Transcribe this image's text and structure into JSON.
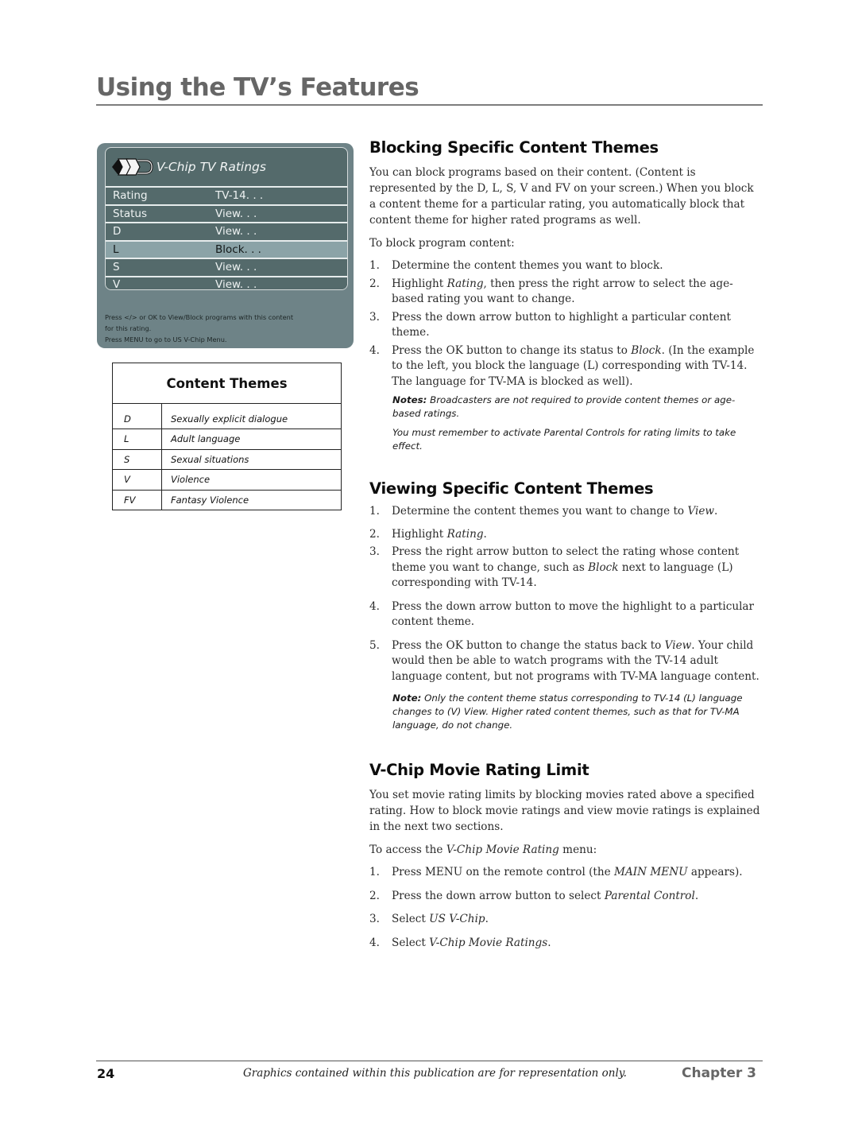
{
  "header": {
    "title": "Using the TV’s Features"
  },
  "tv_menu": {
    "icon": "v-chip-tv-icon",
    "title": "V-Chip TV Ratings",
    "rows": [
      {
        "label": "Rating",
        "value": "TV-14. . .",
        "selected": false
      },
      {
        "label": "Status",
        "value": "View. . .",
        "selected": false
      },
      {
        "label": "D",
        "value": "View. . .",
        "selected": false
      },
      {
        "label": "L",
        "value": "Block. . .",
        "selected": true
      },
      {
        "label": "S",
        "value": "View. . .",
        "selected": false
      },
      {
        "label": "V",
        "value": "View. . .",
        "selected": false
      }
    ],
    "help": [
      "Press </> or OK to View/Block programs with this content",
      "for this rating.",
      "Press MENU to go to US V-Chip Menu."
    ],
    "colors": {
      "panel": "#6e8387",
      "row": "#546a6b",
      "selected_row": "#8ba3a7"
    }
  },
  "content_themes": {
    "title": "Content Themes",
    "rows": [
      {
        "code": "D",
        "desc": "Sexually explicit dialogue"
      },
      {
        "code": "L",
        "desc": "Adult language"
      },
      {
        "code": "S",
        "desc": "Sexual situations"
      },
      {
        "code": "V",
        "desc": "Violence"
      },
      {
        "code": "FV",
        "desc": "Fantasy Violence"
      }
    ]
  },
  "blocking": {
    "heading": "Blocking Specific Content Themes",
    "intro": "You can block programs based on their content. (Content is represented by the D, L, S, V and FV on your screen.) When you block a content theme for a particular rating, you automatically block that content theme for higher rated programs as well.",
    "lead": "To block program content:",
    "steps": [
      {
        "n": "1.",
        "text": "Determine the content themes you want to block."
      },
      {
        "n": "2.",
        "a": "Highlight ",
        "em": "Rating",
        "b": ", then press the right arrow to select the age-based rating you want to change."
      },
      {
        "n": "3.",
        "text": "Press the down arrow button to highlight a particular content theme."
      },
      {
        "n": "4.",
        "a": "Press the OK button to change its status to ",
        "em": "Block",
        "b": ". (In the example to the left, you block the language (L) corresponding with TV-14. The language for TV-MA is blocked as well)."
      }
    ],
    "note_label": "Notes:",
    "note_text": " Broadcasters are not required to provide content themes or age-based ratings.",
    "note2": "You must remember to activate Parental Controls for rating limits to take effect."
  },
  "viewing": {
    "heading": "Viewing Specific Content Themes",
    "steps": [
      {
        "n": "1.",
        "a": "Determine the content themes you want to change to ",
        "em": "View",
        "b": "."
      },
      {
        "n": "2.",
        "a": "Highlight ",
        "em": "Rating",
        "b": "."
      },
      {
        "n": "3.",
        "a": "Press the right arrow button to select the rating whose content theme you want to change, such as ",
        "em": "Block",
        "b": " next to language (L) corresponding with TV-14."
      },
      {
        "n": "4.",
        "text": "Press the down arrow button to move the highlight to a particular content theme."
      },
      {
        "n": "5.",
        "a": "Press the OK button to change the status back to ",
        "em": "View",
        "b": ".  Your child would then be able to watch programs with the TV-14 adult language content, but not programs with TV-MA language content."
      }
    ],
    "note_label": "Note:",
    "note_text": "  Only the content theme status corresponding to TV-14 (L) language changes to (V) View. Higher rated content themes, such as that for TV-MA language, do not change."
  },
  "movie": {
    "heading": "V-Chip Movie Rating Limit",
    "intro": "You set movie rating limits by blocking movies rated above a specified rating. How to block movie ratings and view movie ratings is explained in the next two sections.",
    "lead_a": "To access the ",
    "lead_em": "V-Chip Movie Rating",
    "lead_b": " menu:",
    "steps": [
      {
        "n": "1.",
        "a": "Press MENU on the remote control (the ",
        "em": "MAIN MENU",
        "b": " appears)."
      },
      {
        "n": "2.",
        "a": "Press the down arrow button to select ",
        "em": "Parental Control",
        "b": "."
      },
      {
        "n": "3.",
        "a": "Select ",
        "em": "US V-Chip",
        "b": "."
      },
      {
        "n": "4.",
        "a": "Select ",
        "em": "V-Chip Movie Ratings",
        "b": "."
      }
    ]
  },
  "footer": {
    "page_number": "24",
    "disclaimer": "Graphics contained within this publication are for representation only.",
    "chapter": "Chapter 3"
  }
}
